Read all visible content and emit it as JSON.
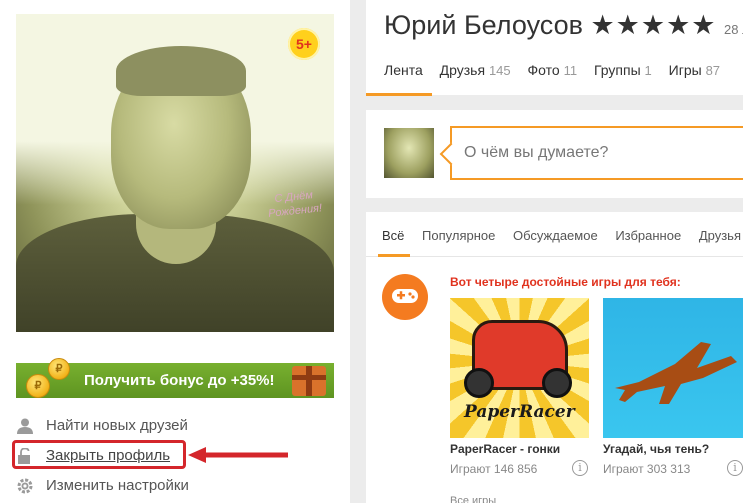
{
  "profile": {
    "age_badge": "5+",
    "photo_card_text": "С Днём Рождения!",
    "name": "Юрий Белоусов",
    "stars": "★★★★★",
    "age_partial": "28 л"
  },
  "tabs": [
    {
      "label": "Лента",
      "count": ""
    },
    {
      "label": "Друзья",
      "count": "145"
    },
    {
      "label": "Фото",
      "count": "11"
    },
    {
      "label": "Группы",
      "count": "1"
    },
    {
      "label": "Игры",
      "count": "87"
    }
  ],
  "bonus": {
    "label": "Получить бонус до +35%!"
  },
  "menu": {
    "find_friends": "Найти новых друзей",
    "close_profile": "Закрыть профиль",
    "settings": "Изменить настройки"
  },
  "post": {
    "placeholder": "О чём вы думаете?"
  },
  "feed_tabs": [
    "Всё",
    "Популярное",
    "Обсуждаемое",
    "Избранное",
    "Друзья"
  ],
  "promo": {
    "title": "Вот четыре достойные игры для тебя:",
    "games": [
      {
        "title": "PaperRacer - гонки",
        "meta": "Играют 146 856",
        "logo": "PaperRacer"
      },
      {
        "title": "Угадай, чья тень?",
        "meta": "Играют 303 313"
      }
    ],
    "more": "Все игры"
  },
  "colors": {
    "accent": "#f59a25",
    "highlight": "#d4262b",
    "bonus": "#6aa329"
  }
}
